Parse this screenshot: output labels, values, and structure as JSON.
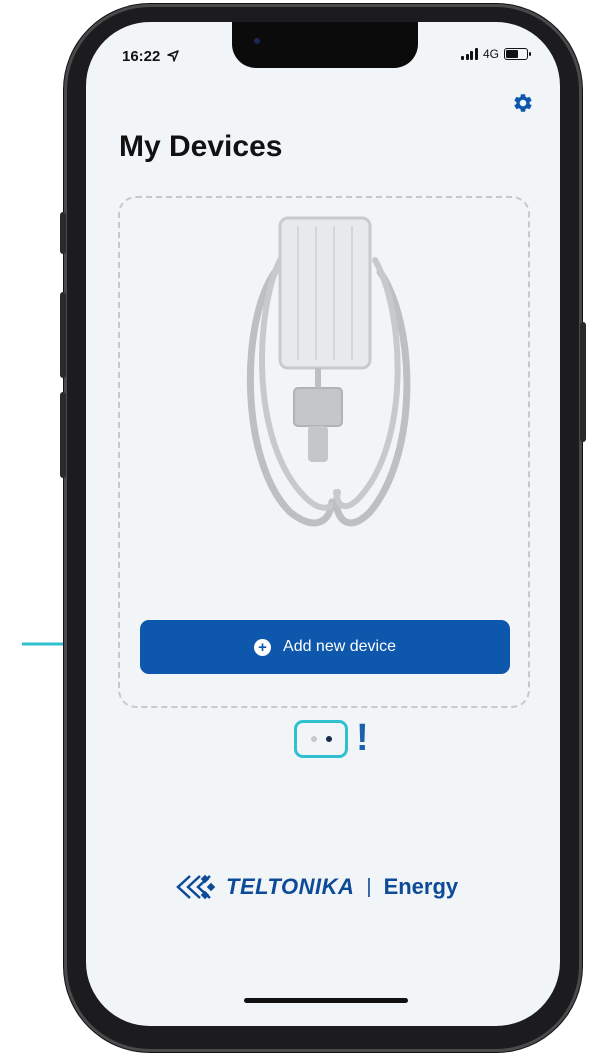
{
  "status_bar": {
    "time": "16:22",
    "location_icon": "location-arrow-icon",
    "network": "4G",
    "signal_icon": "signal-bars-icon",
    "battery_icon": "battery-icon"
  },
  "header": {
    "title": "My Devices",
    "settings_icon": "gear-icon"
  },
  "device_card": {
    "image_icon": "ev-charger-icon",
    "add_button_label": "Add new device",
    "add_button_icon": "plus-circle-icon"
  },
  "pager": {
    "page_count": 2,
    "active_page": 2,
    "callout": "!"
  },
  "brand": {
    "name": "TELTONIKA",
    "separator": "|",
    "suffix": "Energy"
  },
  "colors": {
    "primary": "#0d57ac",
    "highlight": "#2fc0cf",
    "background": "#f2f5f8",
    "brand": "#0d4a97"
  }
}
